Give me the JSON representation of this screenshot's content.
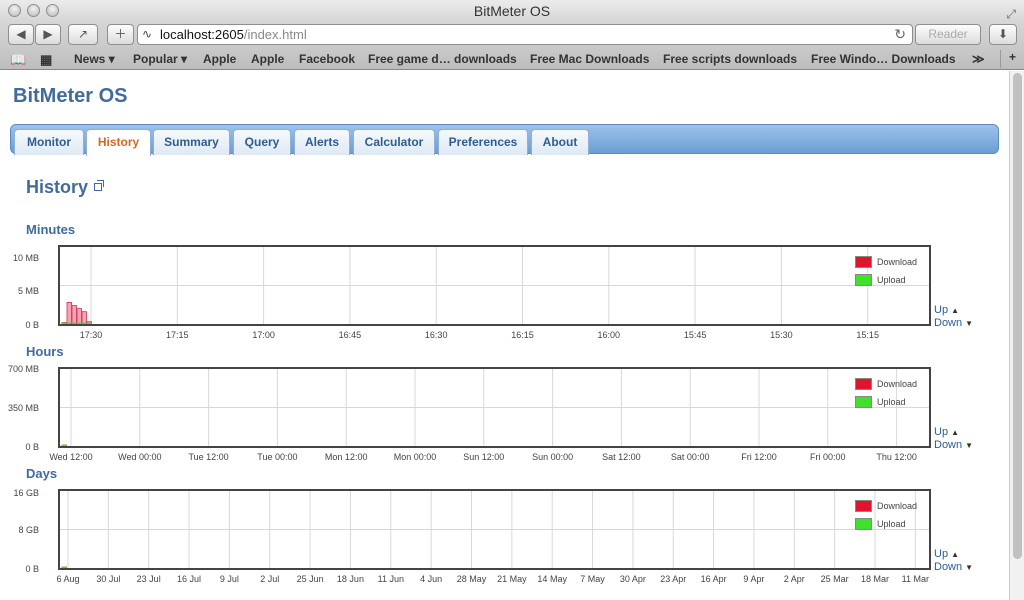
{
  "window": {
    "title": "BitMeter OS"
  },
  "toolbar": {
    "url_host": "localhost:2605",
    "url_path": "/index.html",
    "reader_label": "Reader"
  },
  "bookmarks": [
    "News ▾",
    "Popular ▾",
    "Apple",
    "Apple",
    "Facebook",
    "Free game d… downloads",
    "Free Mac Downloads",
    "Free scripts downloads",
    "Free Windo… Downloads",
    "≫"
  ],
  "app": {
    "title": "BitMeter OS"
  },
  "tabs": [
    "Monitor",
    "History",
    "Summary",
    "Query",
    "Alerts",
    "Calculator",
    "Preferences",
    "About"
  ],
  "active_tab": "History",
  "page_heading": "History",
  "legend": {
    "download": "Download",
    "upload": "Upload"
  },
  "colors": {
    "download": "#e0142c",
    "upload": "#3fe22a",
    "accent": "#416b9c",
    "active_tab": "#d2682a"
  },
  "updown": {
    "up": "Up",
    "down": "Down"
  },
  "charts": [
    {
      "label": "Minutes",
      "y_ticks": [
        "10 MB",
        "5 MB",
        "0 B"
      ],
      "x_ticks": [
        "17:30",
        "17:15",
        "17:00",
        "16:45",
        "16:30",
        "16:15",
        "16:00",
        "15:45",
        "15:30",
        "15:15"
      ]
    },
    {
      "label": "Hours",
      "y_ticks": [
        "700 MB",
        "350 MB",
        "0 B"
      ],
      "x_ticks": [
        "Wed 12:00",
        "Wed 00:00",
        "Tue 12:00",
        "Tue 00:00",
        "Mon 12:00",
        "Mon 00:00",
        "Sun 12:00",
        "Sun 00:00",
        "Sat 12:00",
        "Sat 00:00",
        "Fri 12:00",
        "Fri 00:00",
        "Thu 12:00"
      ]
    },
    {
      "label": "Days",
      "y_ticks": [
        "16 GB",
        "8 GB",
        "0 B"
      ],
      "x_ticks": [
        "6 Aug",
        "30 Jul",
        "23 Jul",
        "16 Jul",
        "9 Jul",
        "2 Jul",
        "25 Jun",
        "18 Jun",
        "11 Jun",
        "4 Jun",
        "28 May",
        "21 May",
        "14 May",
        "7 May",
        "30 Apr",
        "23 Apr",
        "16 Apr",
        "9 Apr",
        "2 Apr",
        "25 Mar",
        "18 Mar",
        "11 Mar"
      ]
    }
  ],
  "chart_data": [
    {
      "type": "bar",
      "title": "Minutes",
      "ylim": [
        0,
        10
      ],
      "yunit": "MB",
      "series": [
        {
          "name": "Download",
          "values": [
            0.2,
            2.8,
            2.4,
            2.0,
            1.6,
            0.3
          ]
        },
        {
          "name": "Upload",
          "values": [
            0.1,
            0.1,
            0.1,
            0.1,
            0.1,
            0.1
          ]
        }
      ]
    },
    {
      "type": "bar",
      "title": "Hours",
      "ylim": [
        0,
        700
      ],
      "yunit": "MB",
      "series": [
        {
          "name": "Download",
          "values": [
            5
          ]
        },
        {
          "name": "Upload",
          "values": [
            2
          ]
        }
      ]
    },
    {
      "type": "bar",
      "title": "Days",
      "ylim": [
        0,
        16
      ],
      "yunit": "GB",
      "series": [
        {
          "name": "Download",
          "values": [
            0.1
          ]
        },
        {
          "name": "Upload",
          "values": [
            0.05
          ]
        }
      ]
    }
  ]
}
